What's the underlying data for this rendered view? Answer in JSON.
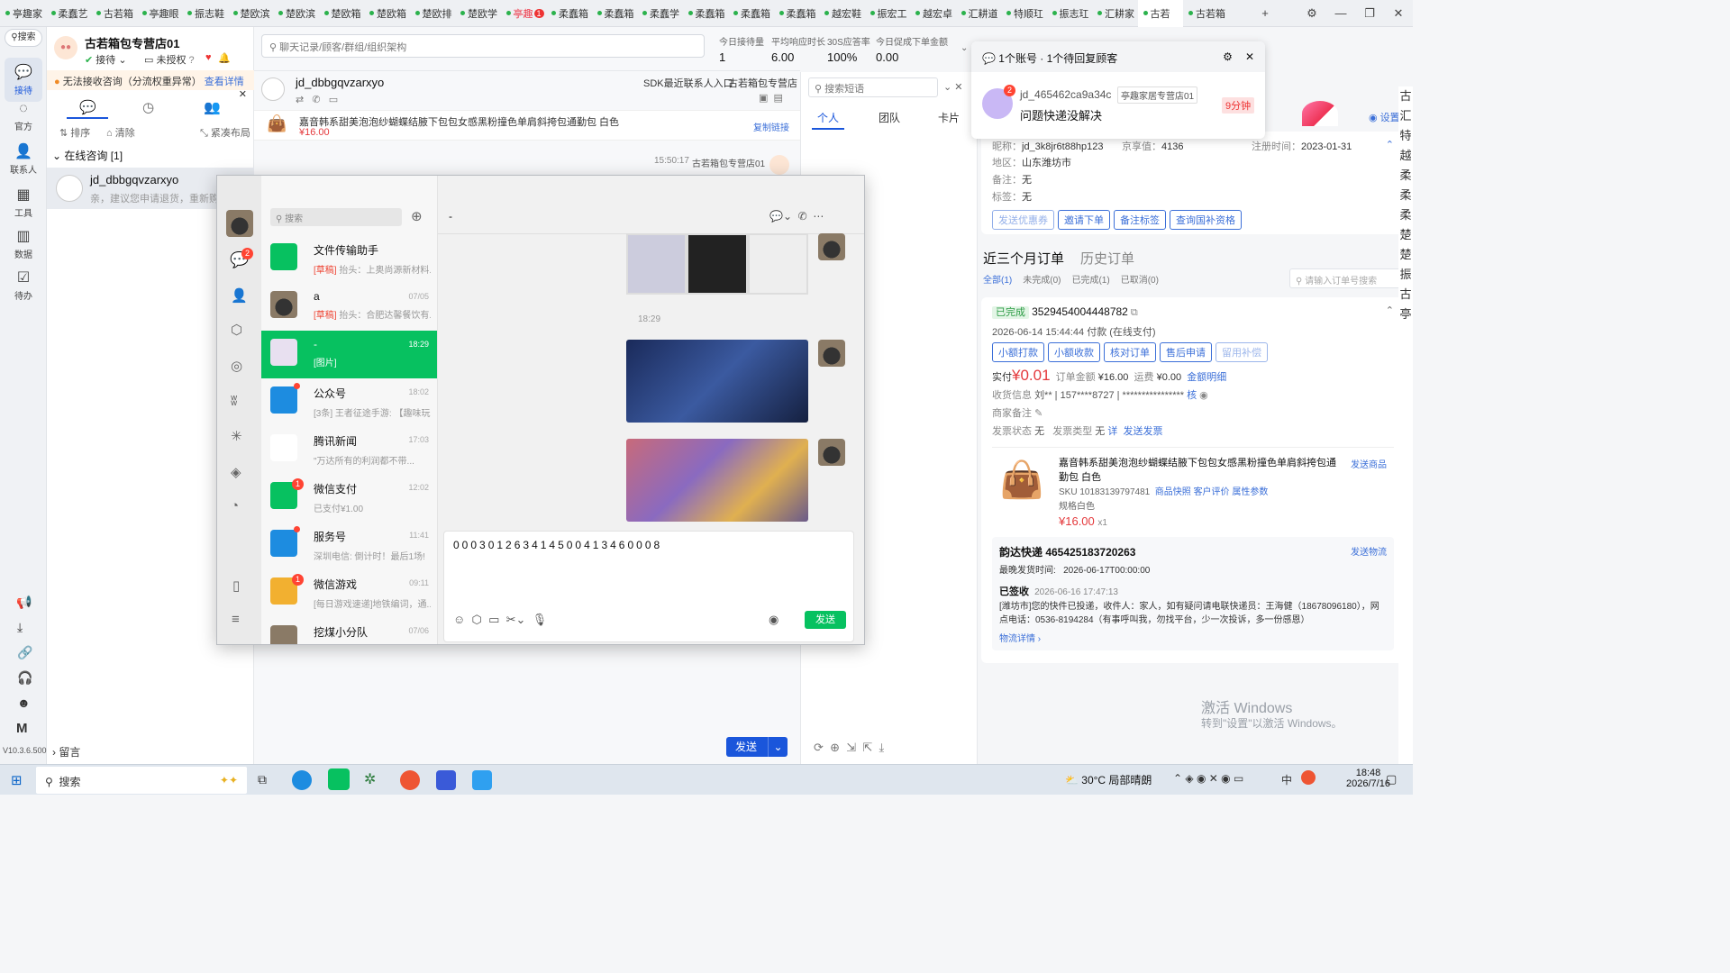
{
  "tabs": [
    {
      "label": "亭趣家",
      "state": ""
    },
    {
      "label": "柔蠢艺",
      "state": ""
    },
    {
      "label": "古若箱",
      "state": ""
    },
    {
      "label": "亭趣眼",
      "state": ""
    },
    {
      "label": "振志鞋",
      "state": ""
    },
    {
      "label": "楚欧滨",
      "state": ""
    },
    {
      "label": "楚欧滨",
      "state": ""
    },
    {
      "label": "楚欧箱",
      "state": ""
    },
    {
      "label": "楚欧箱",
      "state": ""
    },
    {
      "label": "楚欧排",
      "state": ""
    },
    {
      "label": "楚欧学",
      "state": ""
    },
    {
      "label": "亭趣",
      "state": "alert",
      "badge": "1"
    },
    {
      "label": "柔蠢箱",
      "state": ""
    },
    {
      "label": "柔蠢箱",
      "state": ""
    },
    {
      "label": "柔蠢学",
      "state": ""
    },
    {
      "label": "柔蠢箱",
      "state": ""
    },
    {
      "label": "柔蠢箱",
      "state": ""
    },
    {
      "label": "柔蠢箱",
      "state": ""
    },
    {
      "label": "越宏鞋",
      "state": ""
    },
    {
      "label": "振宏工",
      "state": ""
    },
    {
      "label": "越宏卓",
      "state": ""
    },
    {
      "label": "汇耕道",
      "state": ""
    },
    {
      "label": "特顺玒",
      "state": ""
    },
    {
      "label": "振志玒",
      "state": ""
    },
    {
      "label": "汇耕家",
      "state": ""
    },
    {
      "label": "古若",
      "state": "active"
    },
    {
      "label": "古若箱",
      "state": ""
    }
  ],
  "rail": {
    "search": "搜索",
    "items": [
      "接待",
      "官方",
      "联系人",
      "工具",
      "数据",
      "待办"
    ],
    "version": "V10.3.6.500"
  },
  "store": {
    "name": "古若箱包专营店01",
    "status": "接待",
    "auth": "未授权",
    "warning": "无法接收咨询（分流权重异常）",
    "warning_link": "查看详情",
    "sort": "排序",
    "clear": "清除",
    "layout": "紧凑布局",
    "group": "在线咨询 [1]",
    "conv_name": "jd_dbbgqvzarxyo",
    "conv_preview": "亲，建议您申请退货，重新购买",
    "leave_msg": "留言"
  },
  "search": {
    "placeholder": "聊天记录/顾客/群组/组织架构"
  },
  "stats": [
    {
      "label": "今日接待量",
      "value": "1"
    },
    {
      "label": "平均响应时长",
      "value": "6.00"
    },
    {
      "label": "30S应答率",
      "value": "100%"
    },
    {
      "label": "今日促成下单金额",
      "value": "0.00"
    }
  ],
  "chat": {
    "user": "jd_dbbgqvzarxyo",
    "sdk": "SDK最近联系人入口",
    "shop": "古若箱包专营店",
    "product": "嘉音韩系甜美泡泡纱蝴蝶结腋下包包女感黑粉撞色单肩斜挎包通勤包 白色",
    "price": "¥16.00",
    "copy_link": "复制链接",
    "time": "15:50:17",
    "sender": "古若箱包专营店01",
    "send": "发送"
  },
  "mid": {
    "search": "搜索短语",
    "tabs": [
      "个人",
      "团队",
      "卡片"
    ]
  },
  "notify": {
    "title": "1个账号 · 1个待回复顾客",
    "user": "jd_465462ca9a34c",
    "shop": "亭趣家居专营店01",
    "msg": "问题快递没解决",
    "time": "9分钟",
    "badge": "2"
  },
  "customer": {
    "settings": "设置",
    "nick_label": "昵称：",
    "nick": "jd_3k8jr6t88hp123",
    "jx_label": "京享值：",
    "jx": "4136",
    "reg_label": "注册时间：",
    "reg": "2023-01-31",
    "area_label": "地区：",
    "area": "山东潍坊市",
    "note_label": "备注：",
    "note": "无",
    "tag_label": "标签：",
    "tag": "无",
    "buttons": [
      "发送优惠券",
      "邀请下单",
      "备注标签",
      "查询国补资格"
    ]
  },
  "orders": {
    "tab1": "近三个月订单",
    "tab2": "历史订单",
    "filters": [
      "全部(1)",
      "未完成(0)",
      "已完成(1)",
      "已取消(0)"
    ],
    "search": "请输入订单号搜索",
    "status": "已完成",
    "order_no": "3529454004448782",
    "paid_time": "2026-06-14 15:44:44 付款",
    "pay_type": "(在线支付)",
    "actions": [
      "小额打款",
      "小额收款",
      "核对订单",
      "售后申请",
      "留用补偿"
    ],
    "paid_label": "实付",
    "paid": "¥0.01",
    "amount_label": "订单金额",
    "amount": "¥16.00",
    "freight_label": "运费",
    "freight": "¥0.00",
    "detail": "金额明细",
    "recv_label": "收货信息",
    "recv_name": "刘**",
    "recv_phone": "157****8727",
    "recv_addr": "****************",
    "verify": "核",
    "merchant_note": "商家备注",
    "invoice_status_label": "发票状态",
    "invoice_status": "无",
    "invoice_type_label": "发票类型",
    "invoice_type": "无",
    "invoice_detail": "详",
    "send_invoice": "发送发票",
    "product": "嘉音韩系甜美泡泡纱蝴蝶结腋下包包女感黑粉撞色单肩斜挎包通勤包 白色",
    "send_product": "发送商品",
    "sku_label": "SKU",
    "sku": "10183139797481",
    "snapshot": "商品快照",
    "review": "客户评价",
    "attrs": "属性参数",
    "spec": "规格白色",
    "price": "¥16.00",
    "qty": "x1",
    "express": "韵达快递 465425183720263",
    "send_logistics": "发送物流",
    "latest_label": "最晚发货时间:",
    "latest": "2026-06-17T00:00:00",
    "signed": "已签收",
    "signed_time": "2026-06-16 17:47:13",
    "track": "[潍坊市]您的快件已投递，收件人：家人，如有疑问请电联快递员：王海健（18678096180），网点电话：0536-8194284（有事呼叫我，勿找平台，少一次投诉，多一份感恩）",
    "logistics_detail": "物流详情",
    "activate1": "激活 Windows",
    "activate2": "转到\"设置\"以激活 Windows。"
  },
  "wechat": {
    "search": "搜索",
    "chat_title": "-",
    "time_label": "18:29",
    "input": "000301263414500413460008",
    "send": "发送",
    "contacts": [
      {
        "name": "文件传输助手",
        "time": "",
        "draft": "[草稿]",
        "preview": "抬头：上奥尚源新材料...",
        "badge": ""
      },
      {
        "name": "a",
        "time": "07/05",
        "draft": "[草稿]",
        "preview": "抬头：合肥达馨餐饮有...",
        "badge": ""
      },
      {
        "name": "-",
        "time": "18:29",
        "draft": "",
        "preview": "[图片]",
        "badge": ""
      },
      {
        "name": "公众号",
        "time": "18:02",
        "draft": "",
        "preview": "[3条] 王者征途手游: 【趣味玩...",
        "badge": "dot"
      },
      {
        "name": "腾讯新闻",
        "time": "17:03",
        "draft": "",
        "preview": "\"万达所有的利润都不带...",
        "badge": ""
      },
      {
        "name": "微信支付",
        "time": "12:02",
        "draft": "",
        "preview": "已支付¥1.00",
        "badge": "1"
      },
      {
        "name": "服务号",
        "time": "11:41",
        "draft": "",
        "preview": "深圳电信: 倒计时！最后1场!",
        "badge": "dot"
      },
      {
        "name": "微信游戏",
        "time": "09:11",
        "draft": "",
        "preview": "[每日游戏速递]地铁编词，通...",
        "badge": "1"
      },
      {
        "name": "挖煤小分队",
        "time": "07/06",
        "draft": "",
        "preview": "",
        "badge": ""
      }
    ],
    "side_badge": "2"
  },
  "taskbar": {
    "search": "搜索",
    "weather": "30°C 局部晴朗",
    "ime": "中",
    "time": "18:48",
    "date": "2026/7/16"
  },
  "colors": {
    "accent": "#3b6fd8",
    "wechat": "#07c160",
    "red": "#e4393c"
  }
}
